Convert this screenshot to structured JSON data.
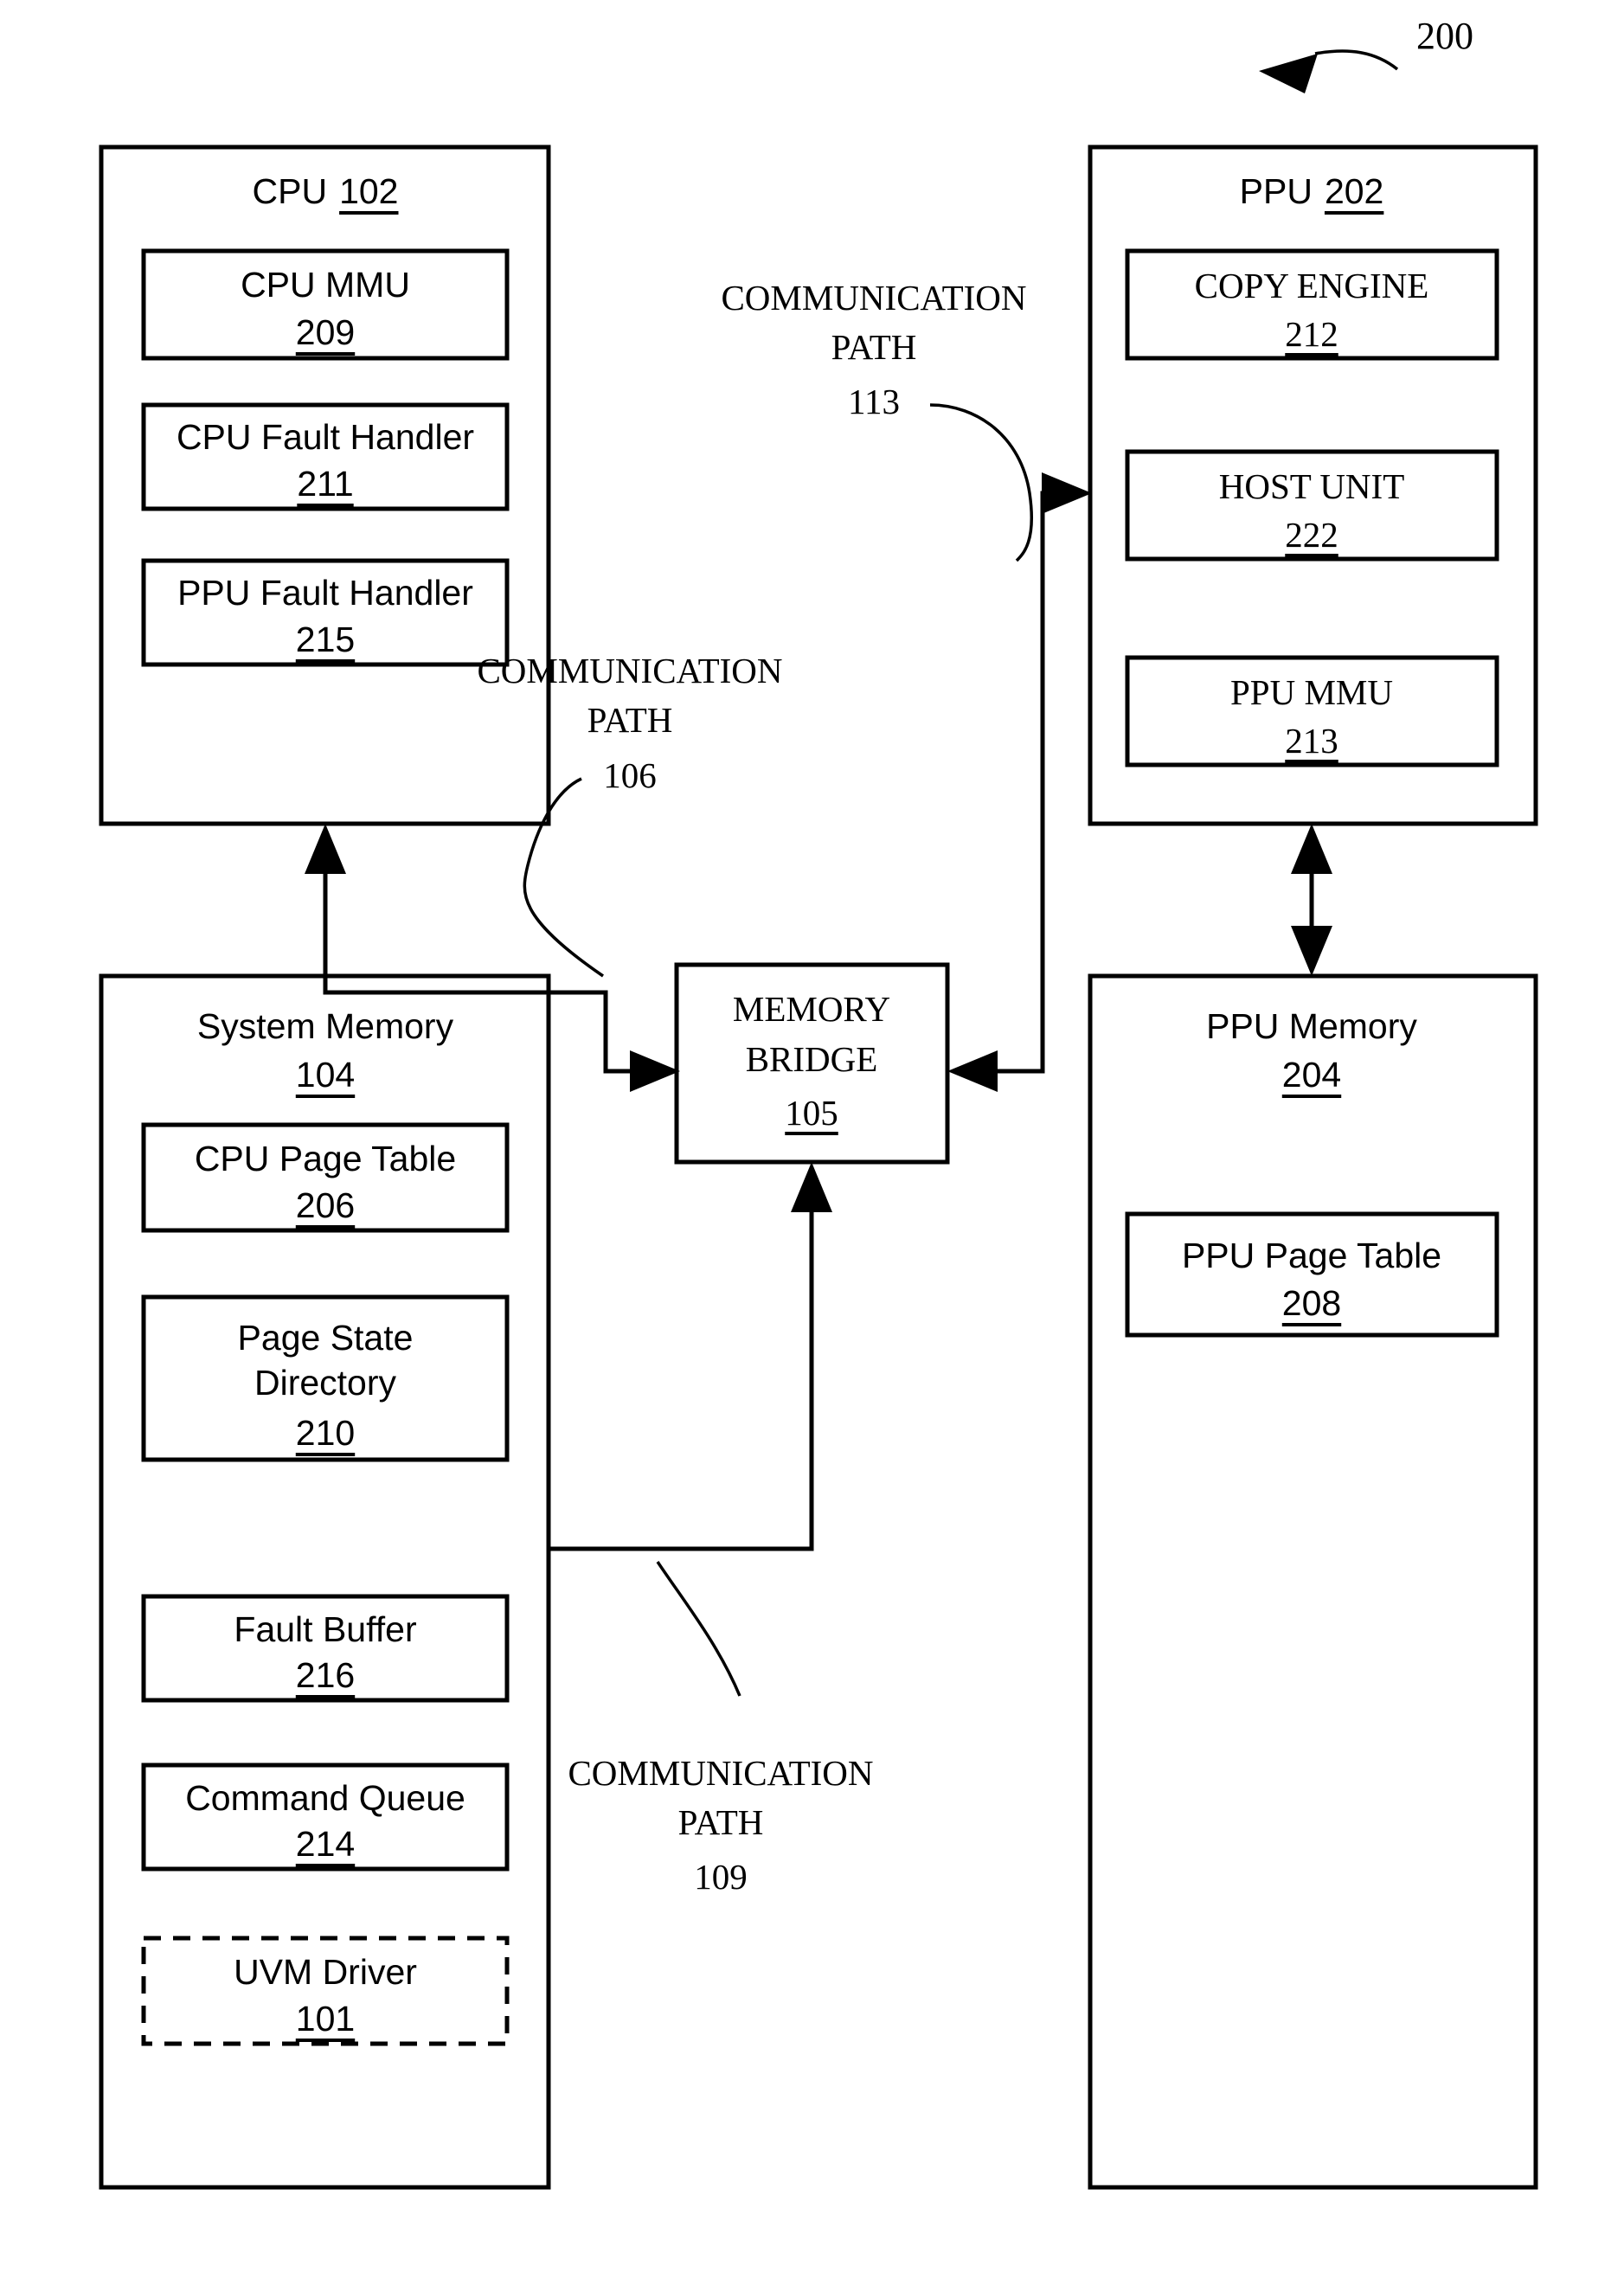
{
  "figure": {
    "number": "200",
    "arrow_icon": "figure-pointer-arrow"
  },
  "blocks": {
    "cpu": {
      "title": "CPU",
      "ref": "102",
      "children": [
        {
          "title": "CPU MMU",
          "ref": "209"
        },
        {
          "title": "CPU Fault Handler",
          "ref": "211"
        },
        {
          "title": "PPU Fault Handler",
          "ref": "215"
        }
      ]
    },
    "ppu": {
      "title": "PPU",
      "ref": "202",
      "children": [
        {
          "title": "COPY ENGINE",
          "ref": "212"
        },
        {
          "title": "HOST UNIT",
          "ref": "222"
        },
        {
          "title": "PPU MMU",
          "ref": "213"
        }
      ]
    },
    "system_memory": {
      "title": "System Memory",
      "ref": "104",
      "children": [
        {
          "title": "CPU Page Table",
          "ref": "206"
        },
        {
          "title_line1": "Page State",
          "title_line2": "Directory",
          "ref": "210"
        },
        {
          "title": "Fault Buffer",
          "ref": "216"
        },
        {
          "title": "Command Queue",
          "ref": "214"
        },
        {
          "title": "UVM Driver",
          "ref": "101",
          "dashed": true
        }
      ]
    },
    "ppu_memory": {
      "title": "PPU Memory",
      "ref": "204",
      "children": [
        {
          "title": "PPU Page Table",
          "ref": "208"
        }
      ]
    },
    "memory_bridge": {
      "title_line1": "MEMORY",
      "title_line2": "BRIDGE",
      "ref": "105"
    }
  },
  "communication_paths": [
    {
      "line1": "COMMUNICATION",
      "line2": "PATH",
      "ref": "113"
    },
    {
      "line1": "COMMUNICATION",
      "line2": "PATH",
      "ref": "106"
    },
    {
      "line1": "COMMUNICATION",
      "line2": "PATH",
      "ref": "109"
    }
  ],
  "colors": {
    "ink": "#000000",
    "paper": "#ffffff"
  }
}
